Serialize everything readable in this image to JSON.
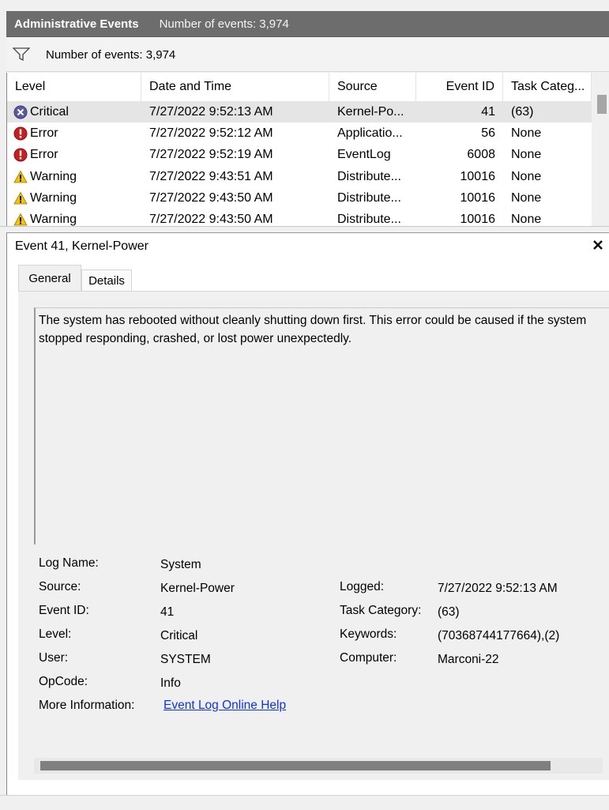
{
  "titlebar": {
    "title": "Administrative Events",
    "count": "Number of events: 3,974"
  },
  "filterbar": {
    "icon": "filter-icon",
    "label": "Number of events: 3,974"
  },
  "list": {
    "columns": [
      "Level",
      "Date and Time",
      "Source",
      "Event ID",
      "Task Categ..."
    ],
    "rows": [
      {
        "level": "Critical",
        "icon": "critical-icon",
        "date": "7/27/2022 9:52:13 AM",
        "source": "Kernel-Po...",
        "id": "41",
        "task": "(63)",
        "selected": true
      },
      {
        "level": "Error",
        "icon": "error-icon",
        "date": "7/27/2022 9:52:12 AM",
        "source": "Applicatio...",
        "id": "56",
        "task": "None"
      },
      {
        "level": "Error",
        "icon": "error-icon",
        "date": "7/27/2022 9:52:19 AM",
        "source": "EventLog",
        "id": "6008",
        "task": "None"
      },
      {
        "level": "Warning",
        "icon": "warning-icon",
        "date": "7/27/2022 9:43:51 AM",
        "source": "Distribute...",
        "id": "10016",
        "task": "None"
      },
      {
        "level": "Warning",
        "icon": "warning-icon",
        "date": "7/27/2022 9:43:50 AM",
        "source": "Distribute...",
        "id": "10016",
        "task": "None"
      },
      {
        "level": "Warning",
        "icon": "warning-icon",
        "date": "7/27/2022 9:43:50 AM",
        "source": "Distribute...",
        "id": "10016",
        "task": "None"
      }
    ]
  },
  "detail": {
    "title": "Event 41, Kernel-Power",
    "tabs": [
      "General",
      "Details"
    ],
    "description": "The system has rebooted without cleanly shutting down first. This error could be caused if the system stopped responding, crashed, or lost power unexpectedly.",
    "props": {
      "log_name_label": "Log Name:",
      "log_name": "System",
      "source_label": "Source:",
      "source": "Kernel-Power",
      "event_id_label": "Event ID:",
      "event_id": "41",
      "level_label": "Level:",
      "level": "Critical",
      "user_label": "User:",
      "user": "SYSTEM",
      "opcode_label": "OpCode:",
      "opcode": "Info",
      "more_info_label": "More Information:",
      "more_info_link": "Event Log Online Help",
      "logged_label": "Logged:",
      "logged": "7/27/2022 9:52:13 AM",
      "task_category_label": "Task Category:",
      "task_category": "(63)",
      "keywords_label": "Keywords:",
      "keywords": "(70368744177664),(2)",
      "computer_label": "Computer:",
      "computer": "Marconi-22"
    }
  },
  "colors": {
    "titlebar": "#6d6d6d",
    "selected_row": "#e5e5e5",
    "link": "#0b34e6",
    "critical": "#5a5a9e",
    "error": "#c81e1e",
    "warning": "#f5c400"
  }
}
